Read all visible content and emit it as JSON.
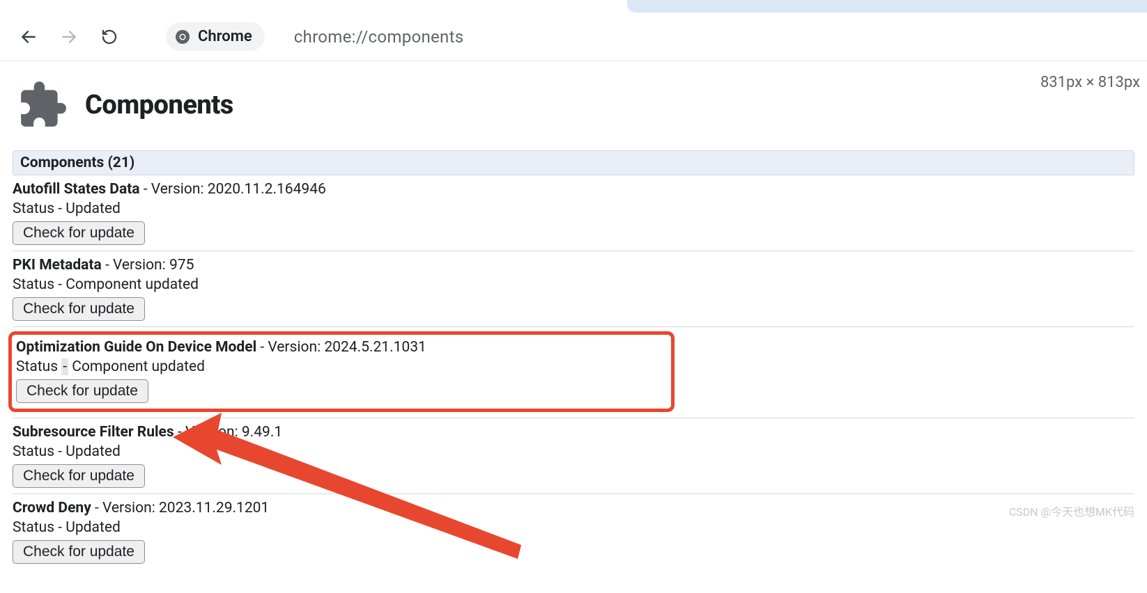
{
  "browser": {
    "chip_label": "Chrome",
    "url": "chrome://components"
  },
  "dim_info": "831px × 813px",
  "page_title": "Components",
  "section_header": "Components (21)",
  "version_label": "Version:",
  "status_label_prefix": "Status",
  "check_button_label": "Check for update",
  "components": [
    {
      "name": "Autofill States Data",
      "version": "2020.11.2.164946",
      "status": "Updated",
      "highlighted": false
    },
    {
      "name": "PKI Metadata",
      "version": "975",
      "status": "Component updated",
      "highlighted": false
    },
    {
      "name": "Optimization Guide On Device Model",
      "version": "2024.5.21.1031",
      "status": "Component updated",
      "highlighted": true
    },
    {
      "name": "Subresource Filter Rules",
      "version": "9.49.1",
      "status": "Updated",
      "highlighted": false
    },
    {
      "name": "Crowd Deny",
      "version": "2023.11.29.1201",
      "status": "Updated",
      "highlighted": false
    }
  ],
  "watermark": "CSDN @今天也想MK代码"
}
